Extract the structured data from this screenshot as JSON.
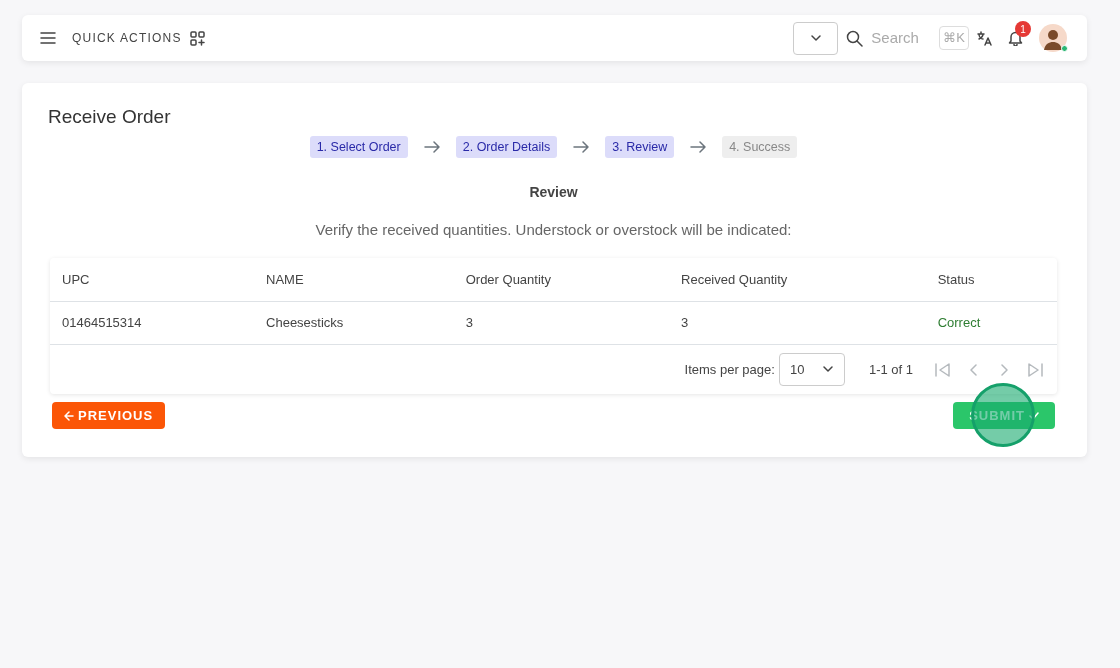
{
  "header": {
    "title": "QUICK ACTIONS",
    "search_placeholder": "Search",
    "shortcut": "⌘K",
    "notification_count": "1",
    "user_online": true
  },
  "page": {
    "title": "Receive Order"
  },
  "steps": [
    {
      "label": "1. Select Order",
      "done": true
    },
    {
      "label": "2. Order Details",
      "done": true
    },
    {
      "label": "3. Review",
      "done": true
    },
    {
      "label": "4. Success",
      "done": false
    }
  ],
  "review": {
    "heading": "Review",
    "instructions": "Verify the received quantities. Understock or overstock will be indicated:"
  },
  "table": {
    "columns": [
      "UPC",
      "NAME",
      "Order Quantity",
      "Received Quantity",
      "Status"
    ],
    "rows": [
      {
        "cells": [
          "01464515314",
          "Cheesesticks",
          "3",
          "3"
        ],
        "status": {
          "text": "Correct",
          "kind": "correct"
        }
      }
    ]
  },
  "pagination": {
    "label": "Items per page:",
    "per_page": "10",
    "range": "1-1 of 1",
    "first_disabled": true,
    "prev_disabled": true,
    "next_disabled": true,
    "last_disabled": true
  },
  "buttons": {
    "previous": "PREVIOUS",
    "submit": "SUBMIT"
  },
  "click_marker": true
}
